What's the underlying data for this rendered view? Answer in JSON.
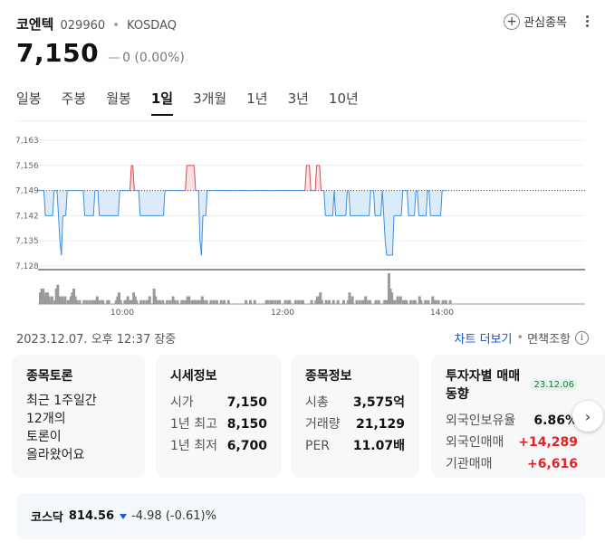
{
  "header": {
    "name": "코엔텍",
    "code": "029960",
    "separator": "•",
    "market": "KOSDAQ",
    "favorite_label": "관심종목"
  },
  "price": {
    "value": "7,150",
    "change_marker": "—",
    "change": "0 (0.00%)"
  },
  "tabs": [
    {
      "label": "일봉"
    },
    {
      "label": "주봉"
    },
    {
      "label": "월봉"
    },
    {
      "label": "1일",
      "active": true
    },
    {
      "label": "3개월"
    },
    {
      "label": "1년"
    },
    {
      "label": "3년"
    },
    {
      "label": "10년"
    }
  ],
  "chart_data": {
    "type": "line",
    "y_ticks": [
      "7,163",
      "7,156",
      "7,149",
      "7,142",
      "7,135",
      "7,128"
    ],
    "ylim": [
      7128,
      7163
    ],
    "reference_value": 7149,
    "x_ticks": [
      "10:00",
      "12:00",
      "14:00"
    ],
    "series": [
      {
        "values": [
          7149,
          7149,
          7149,
          7149,
          7149,
          7142,
          7142,
          7142,
          7142,
          7142,
          7142,
          7149,
          7149,
          7149,
          7142,
          7135,
          7131,
          7142,
          7142,
          7142,
          7149,
          7149,
          7149,
          7149,
          7149,
          7149,
          7149,
          7149,
          7149,
          7149,
          7149,
          7149,
          7142,
          7142,
          7142,
          7142,
          7142,
          7142,
          7142,
          7149,
          7149,
          7149,
          7142,
          7142,
          7142,
          7142,
          7142,
          7142,
          7142,
          7142,
          7142,
          7142,
          7142,
          7142,
          7142,
          7142,
          7149,
          7149,
          7149,
          7149,
          7149,
          7149,
          7149,
          7149,
          7156,
          7156,
          7149,
          7149,
          7149,
          7149,
          7142,
          7142,
          7142,
          7142,
          7142,
          7142,
          7142,
          7142,
          7142,
          7142,
          7142,
          7142,
          7142,
          7142,
          7142,
          7142,
          7142,
          7149,
          7149,
          7149,
          7149,
          7149,
          7149,
          7149,
          7149,
          7149,
          7149,
          7149,
          7149,
          7149,
          7149,
          7149,
          7156,
          7156,
          7156,
          7156,
          7156,
          7156,
          7149,
          7149,
          7149,
          7135,
          7131,
          7142,
          7142,
          7142,
          7149,
          7149,
          7149,
          7149,
          7149,
          7149,
          7149,
          7149,
          7149,
          7149,
          7149,
          7149,
          7149,
          7149,
          7149,
          7149,
          7149,
          7149,
          7149,
          7149,
          7149,
          7149,
          7149,
          7149,
          7149,
          7149,
          7149,
          7149,
          7149,
          7149,
          7149,
          7149,
          7149,
          7149,
          7149,
          7149,
          7149,
          7149,
          7149,
          7149,
          7149,
          7149,
          7149,
          7149,
          7149,
          7149,
          7149,
          7149,
          7149,
          7149,
          7149,
          7149,
          7149,
          7149,
          7149,
          7149,
          7149,
          7149,
          7149,
          7149,
          7149,
          7149,
          7149,
          7149,
          7149,
          7149,
          7149,
          7149,
          7156,
          7156,
          7156,
          7149,
          7149,
          7149,
          7149,
          7156,
          7156,
          7156,
          7149,
          7149,
          7149,
          7142,
          7142,
          7142,
          7142,
          7142,
          7142,
          7149,
          7142,
          7142,
          7142,
          7142,
          7142,
          7142,
          7142,
          7142,
          7149,
          7149,
          7142,
          7142,
          7142,
          7142,
          7142,
          7142,
          7142,
          7142,
          7142,
          7142,
          7142,
          7142,
          7142,
          7142,
          7149,
          7149,
          7149,
          7142,
          7142,
          7142,
          7142,
          7142,
          7149,
          7142,
          7135,
          7131,
          7131,
          7131,
          7131,
          7131,
          7142,
          7142,
          7142,
          7142,
          7142,
          7142,
          7149,
          7149,
          7149,
          7149,
          7142,
          7142,
          7142,
          7142,
          7142,
          7149,
          7149,
          7142,
          7142,
          7142,
          7142,
          7142,
          7142,
          7149,
          7149,
          7142,
          7142,
          7142,
          7142,
          7142,
          7142,
          7142,
          7142,
          7149,
          7149,
          7149
        ]
      }
    ],
    "volume": [
      3,
      4,
      4,
      2,
      3,
      3,
      2,
      1,
      2,
      0,
      1,
      4,
      5,
      2,
      1,
      2,
      1,
      2,
      0,
      1,
      1,
      2,
      3,
      4,
      2,
      1,
      0,
      1,
      0,
      0,
      1,
      0,
      1,
      0,
      1,
      0,
      1,
      1,
      1,
      2,
      1,
      0,
      1,
      1,
      0,
      0,
      1,
      1,
      0,
      0,
      0,
      0,
      1,
      2,
      3,
      1,
      0,
      0,
      1,
      1,
      2,
      1,
      1,
      1,
      3,
      2,
      1,
      0,
      0,
      1,
      0,
      1,
      0,
      1,
      1,
      2,
      0,
      0,
      4,
      2,
      1,
      0,
      1,
      0,
      1,
      0,
      0,
      1,
      0,
      1,
      0,
      2,
      1,
      0,
      1,
      0,
      0,
      1,
      1,
      0,
      1,
      2,
      2,
      0,
      1,
      1,
      1,
      1,
      1,
      1,
      1,
      2,
      1,
      0,
      1,
      0,
      0,
      1,
      0,
      1,
      0,
      1,
      0,
      0,
      1,
      0,
      1,
      0,
      0,
      1,
      0,
      0,
      0,
      0,
      0,
      0,
      0,
      0,
      0,
      0,
      0,
      1,
      0,
      0,
      1,
      0,
      0,
      1,
      0,
      0,
      0,
      0,
      0,
      0,
      0,
      1,
      1,
      0,
      1,
      1,
      0,
      1,
      0,
      1,
      1,
      0,
      0,
      0,
      1,
      0,
      1,
      1,
      0,
      0,
      0,
      1,
      0,
      1,
      0,
      1,
      1,
      0,
      0,
      0,
      0,
      0,
      1,
      0,
      0,
      1,
      2,
      2,
      3,
      1,
      0,
      0,
      1,
      0,
      1,
      0,
      0,
      1,
      0,
      0,
      1,
      0,
      0,
      0,
      1,
      0,
      0,
      1,
      3,
      1,
      2,
      0,
      0,
      1,
      0,
      1,
      0,
      1,
      1,
      2,
      1,
      0,
      1,
      0,
      0,
      0,
      1,
      0,
      1,
      0,
      0,
      0,
      1,
      1,
      1,
      8,
      4,
      3,
      1,
      1,
      0,
      2,
      1,
      2,
      0,
      1,
      1,
      1,
      0,
      0,
      1,
      0,
      1,
      1,
      0,
      0,
      2,
      1,
      0,
      0,
      1,
      0,
      1,
      0,
      0,
      2,
      1,
      1,
      0,
      1,
      0,
      0,
      1,
      0,
      1,
      0,
      0,
      1
    ]
  },
  "chart_colors": {
    "up_line": "#e0464e",
    "up_fill": "#fbe1e2",
    "down_line": "#3b8ede",
    "down_fill": "#dcebfa",
    "volume": "#9a9a9a",
    "axis": "#222222",
    "grid": "#eeeeee"
  },
  "timestamp": {
    "text": "2023.12.07. 오후 12:37 장중",
    "chart_more": "차트 더보기",
    "separator": "•",
    "disclaimer": "면책조항",
    "info_icon": "i"
  },
  "cards": {
    "discussion": {
      "title": "종목토론",
      "lines": [
        "최근 1주일간",
        "12개의",
        "토론이",
        "올라왔어요"
      ]
    },
    "quote": {
      "title": "시세정보",
      "rows": [
        {
          "label": "시가",
          "value": "7,150"
        },
        {
          "label": "1년 최고",
          "value": "8,150"
        },
        {
          "label": "1년 최저",
          "value": "6,700"
        }
      ]
    },
    "stockinfo": {
      "title": "종목정보",
      "rows": [
        {
          "label": "시총",
          "value": "3,575억"
        },
        {
          "label": "거래량",
          "value": "21,129"
        },
        {
          "label": "PER",
          "value": "11.07배"
        }
      ]
    },
    "investor": {
      "title": "투자자별 매매동향",
      "date": "23.12.06",
      "rows": [
        {
          "label": "외국인보유율",
          "value": "6.86%"
        },
        {
          "label": "외국인매매",
          "value": "+14,289"
        },
        {
          "label": "기관매매",
          "value": "+6,616"
        }
      ]
    }
  },
  "next_arrow": "›",
  "index_bar": {
    "name": "코스닥",
    "value": "814.56",
    "change": "-4.98 (-0.61)%",
    "down_color": "#1a5fd0"
  }
}
